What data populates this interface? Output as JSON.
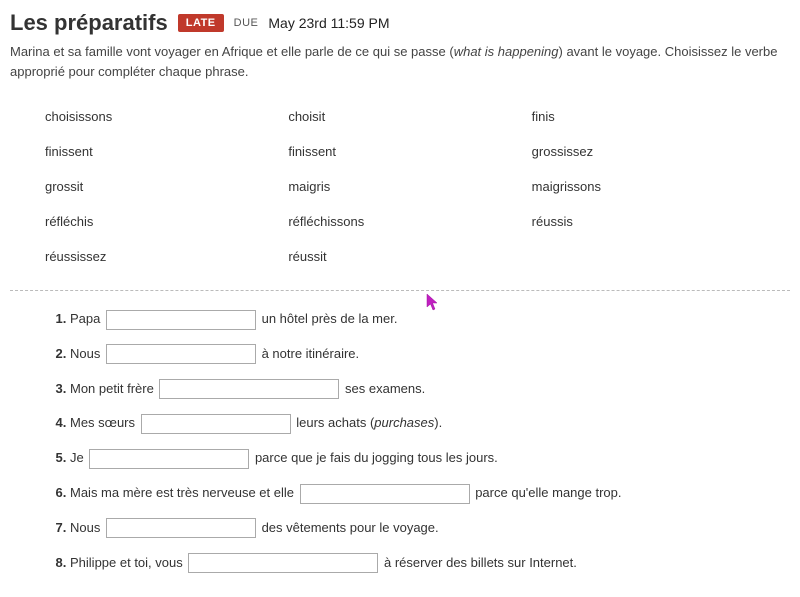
{
  "header": {
    "title": "Les préparatifs",
    "badge": "LATE",
    "due_label": "DUE",
    "due_date": "May 23rd 11:59 PM"
  },
  "instructions": {
    "pre": "Marina et sa famille vont voyager en Afrique et elle parle de ce qui se passe (",
    "italic": "what is happening",
    "post": ") avant le voyage. Choisissez le verbe approprié pour compléter chaque phrase."
  },
  "word_bank": [
    "choisissons",
    "choisit",
    "finis",
    "finissent",
    "finissent",
    "grossissez",
    "grossit",
    "maigris",
    "maigrissons",
    "réfléchis",
    "réfléchissons",
    "réussis",
    "réussissez",
    "réussit",
    ""
  ],
  "questions": {
    "q1": {
      "before": "Papa ",
      "after": " un hôtel près de la mer."
    },
    "q2": {
      "before": "Nous ",
      "after": " à notre itinéraire."
    },
    "q3": {
      "before": "Mon petit frère ",
      "after": " ses examens."
    },
    "q4": {
      "before": "Mes sœurs ",
      "after_pre": " leurs achats (",
      "after_italic": "purchases",
      "after_post": ")."
    },
    "q5": {
      "before": "Je ",
      "after": " parce que je fais du jogging tous les jours."
    },
    "q6": {
      "before": "Mais ma mère est très nerveuse et elle ",
      "after": " parce qu'elle mange trop."
    },
    "q7": {
      "before": "Nous ",
      "after": " des vêtements pour le voyage."
    },
    "q8": {
      "before": "Philippe et toi, vous ",
      "after": " à réserver des billets sur Internet."
    }
  }
}
